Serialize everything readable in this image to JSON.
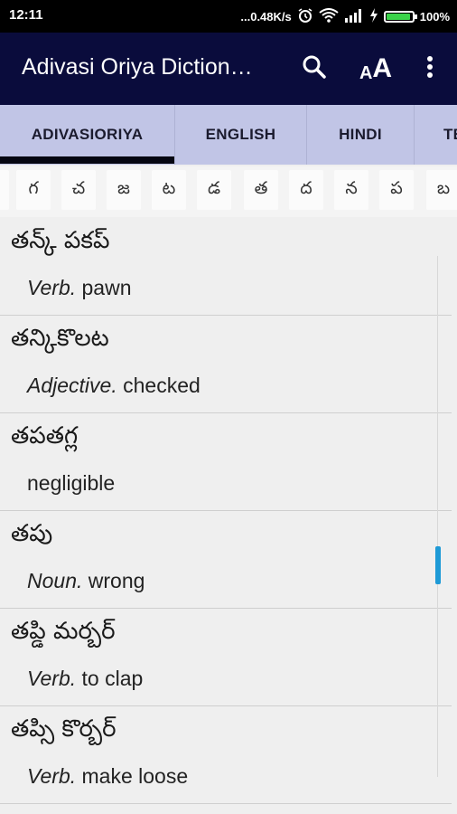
{
  "status_bar": {
    "time": "12:11",
    "network_speed": "...0.48K/s",
    "battery_percent": "100%",
    "battery_level": 1.0
  },
  "app_bar": {
    "title": "Adivasi Oriya Diction…",
    "search_icon": "search-icon",
    "font_size_icon": "font-size-icon",
    "font_size_glyph": "AA",
    "more_icon": "more-vert-icon"
  },
  "tabs": {
    "items": [
      {
        "label": "ADIVASIORIYA",
        "active": true
      },
      {
        "label": "ENGLISH"
      },
      {
        "label": "HINDI"
      },
      {
        "label": "TE"
      }
    ]
  },
  "letters": [
    "",
    "గ",
    "చ",
    "జ",
    "ట",
    "డ",
    "త",
    "ద",
    "న",
    "ప",
    "బ"
  ],
  "entries": [
    {
      "word": "తన్క్ పకప్",
      "pos": "Verb.",
      "meaning": " pawn"
    },
    {
      "word": "తన్కికొలట",
      "pos": "Adjective.",
      "meaning": " checked"
    },
    {
      "word": "తపతగ్ల",
      "pos": "",
      "meaning": "negligible"
    },
    {
      "word": "తపు",
      "pos": "Noun.",
      "meaning": " wrong"
    },
    {
      "word": "తప్డి మర్బర్",
      "pos": "Verb.",
      "meaning": " to clap"
    },
    {
      "word": "తప్సి కొర్బర్",
      "pos": "Verb.",
      "meaning": " make loose"
    }
  ],
  "colors": {
    "app_bar": "#0a0c3c",
    "tab_bar": "#c1c5e6",
    "scroll_thumb": "#1e9ad6",
    "battery_fill": "#3bd34a"
  }
}
